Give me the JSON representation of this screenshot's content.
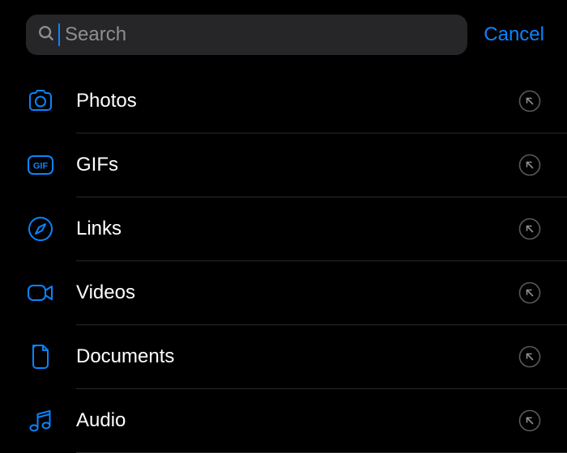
{
  "search": {
    "placeholder": "Search",
    "value": "",
    "cancel_label": "Cancel"
  },
  "accent_color": "#0a84ff",
  "categories": [
    {
      "id": "photos",
      "label": "Photos",
      "icon": "camera-icon"
    },
    {
      "id": "gifs",
      "label": "GIFs",
      "icon": "gif-icon"
    },
    {
      "id": "links",
      "label": "Links",
      "icon": "compass-icon"
    },
    {
      "id": "videos",
      "label": "Videos",
      "icon": "video-icon"
    },
    {
      "id": "documents",
      "label": "Documents",
      "icon": "document-icon"
    },
    {
      "id": "audio",
      "label": "Audio",
      "icon": "music-icon"
    }
  ]
}
